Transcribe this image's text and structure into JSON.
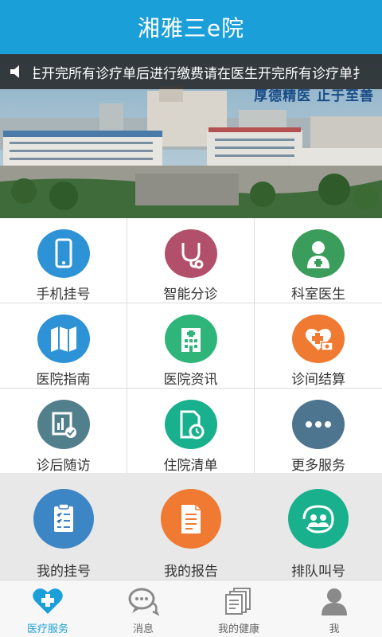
{
  "header": {
    "title": "湘雅三e院"
  },
  "notice": {
    "text_left": "请在医生开完所有诊疗单后进行缴费！",
    "text_right": "请在医生开完所有诊疗单扌"
  },
  "banner": {
    "slogan": "厚德精医  止于至善",
    "slides": 2,
    "active_slide": 2
  },
  "services": [
    {
      "label": "手机挂号",
      "icon": "mobile-phone-icon",
      "color": "#2e93d6"
    },
    {
      "label": "智能分诊",
      "icon": "stethoscope-icon",
      "color": "#b2506b"
    },
    {
      "label": "科室医生",
      "icon": "doctor-icon",
      "color": "#3a9d5c"
    },
    {
      "label": "医院指南",
      "icon": "map-icon",
      "color": "#2e93d6"
    },
    {
      "label": "医院资讯",
      "icon": "hospital-building-icon",
      "color": "#2fb57a"
    },
    {
      "label": "诊间结算",
      "icon": "medical-payment-icon",
      "color": "#f07a32"
    },
    {
      "label": "诊后随访",
      "icon": "chart-report-icon",
      "color": "#527f8c"
    },
    {
      "label": "住院清单",
      "icon": "document-clock-icon",
      "color": "#18b08d"
    },
    {
      "label": "更多服务",
      "icon": "more-dots-icon",
      "color": "#4e7590"
    }
  ],
  "quick": [
    {
      "label": "我的挂号",
      "icon": "clipboard-icon",
      "color": "#3c86c6"
    },
    {
      "label": "我的报告",
      "icon": "report-document-icon",
      "color": "#f07a32"
    },
    {
      "label": "排队叫号",
      "icon": "queue-people-icon",
      "color": "#18b08d"
    }
  ],
  "tabs": [
    {
      "label": "医疗服务",
      "icon": "heart-plus-icon",
      "active": true
    },
    {
      "label": "消息",
      "icon": "chat-bubble-icon",
      "active": false
    },
    {
      "label": "我的健康",
      "icon": "health-records-icon",
      "active": false
    },
    {
      "label": "我",
      "icon": "user-profile-icon",
      "active": false
    }
  ],
  "colors": {
    "primary": "#1a9fd9",
    "tab_active": "#1a9fd9",
    "tab_inactive": "#8a8a8a"
  }
}
